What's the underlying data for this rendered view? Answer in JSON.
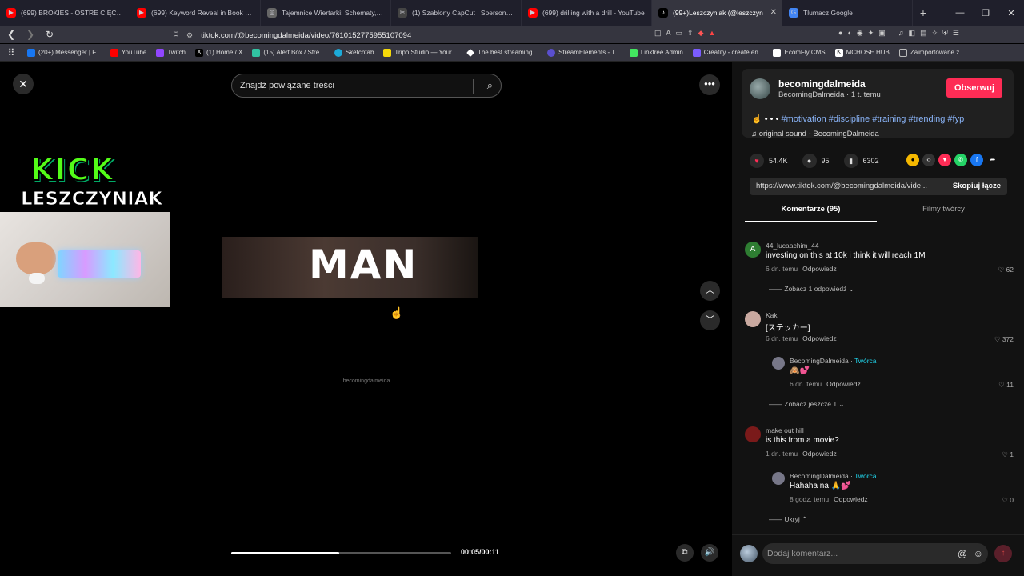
{
  "tabs": [
    {
      "label": "(699) BROKIES - OSTRE CIĘCIE - YouT",
      "color": "#ff0000",
      "icon": "youtube-icon"
    },
    {
      "label": "(699) Keyword Reveal in Book effect",
      "color": "#ff0000",
      "icon": "youtube-icon"
    },
    {
      "label": "Tajemnice Wiertarki: Schematy, Fizyk",
      "color": "#888888",
      "icon": "globe-icon"
    },
    {
      "label": "(1) Szablony CapCut | Spersonaliz",
      "color": "#444444",
      "icon": "capcut-icon"
    },
    {
      "label": "(699) drilling with a drill - YouTube",
      "color": "#ff0000",
      "icon": "youtube-icon"
    },
    {
      "label": "(99+)Leszczyniak (@leszczyn",
      "color": "#000000",
      "icon": "tiktok-icon"
    },
    {
      "label": "Tlumacz Google",
      "color": "#4285f4",
      "icon": "translate-icon"
    }
  ],
  "address": {
    "url": "tiktok.com/@becomingdalmeida/video/7610152775955107094"
  },
  "bookmarks": [
    {
      "label": "(20+) Messenger | F...",
      "color": "#1877f2"
    },
    {
      "label": "YouTube",
      "color": "#ff0000"
    },
    {
      "label": "Twitch",
      "color": "#9146ff"
    },
    {
      "label": "(1) Home / X",
      "color": "#000000"
    },
    {
      "label": "(15) Alert Box / Stre...",
      "color": "#31c3a2"
    },
    {
      "label": "Sketchfab",
      "color": "#1caad9"
    },
    {
      "label": "Tripo Studio — Your...",
      "color": "#f5d90a"
    },
    {
      "label": "The best streaming...",
      "color": "#ffffff"
    },
    {
      "label": "StreamElements - T...",
      "color": "#5a4fcf"
    },
    {
      "label": "Linktree Admin",
      "color": "#43e660"
    },
    {
      "label": "Creatify - create en...",
      "color": "#7a5cff"
    },
    {
      "label": "EcomFly CMS",
      "color": "#ffffff"
    },
    {
      "label": "MCHOSE HUB",
      "color": "#ffffff"
    },
    {
      "label": "Zaimportowane z...",
      "color": "#999999"
    }
  ],
  "stream": {
    "kick": "KICK",
    "name": "LESZCZYNIAK"
  },
  "video": {
    "search_placeholder": "Znajdź powiązane treści",
    "overlay_text": "MAN",
    "watermark": "becomingdalmeida",
    "time": "00:05/00:11",
    "progress": 0.49
  },
  "post": {
    "username": "becomingdalmeida",
    "subtitle": "BecomingDalmeida · 1 t. temu",
    "follow": "Obserwuj",
    "desc_prefix": "☝️ • • •",
    "hashtags": "#motivation #discipline #training #trending #fyp",
    "sound": "original sound - BecomingDalmeida",
    "likes": "54.4K",
    "comments": "95",
    "saves": "6302",
    "link": "https://www.tiktok.com/@becomingdalmeida/vide...",
    "copy": "Skopiuj łącze"
  },
  "panel_tabs": {
    "comments": "Komentarze (95)",
    "creator": "Filmy twórcy"
  },
  "comments": [
    {
      "user": "44_lucaachim_44",
      "text": "investing on this at 10k i think it will reach 1M",
      "time": "6 dn. temu",
      "reply": "Odpowiedz",
      "likes": "62",
      "more": "Zobacz 1 odpowiedź"
    },
    {
      "user": "Kak",
      "text": "[ステッカー]",
      "time": "6 dn. temu",
      "reply": "Odpowiedz",
      "likes": "372"
    },
    {
      "user": "BecomingDalmeida",
      "badge": "Twórca",
      "text": "🙈💕",
      "time": "6 dn. temu",
      "reply": "Odpowiedz",
      "likes": "11",
      "more": "Zobacz jeszcze 1"
    },
    {
      "user": "make out hill",
      "text": "is this from a movie?",
      "time": "1 dn. temu",
      "reply": "Odpowiedz",
      "likes": "1"
    },
    {
      "user": "BecomingDalmeida",
      "badge": "Twórca",
      "text": "Hahaha na 🙏💕",
      "time": "8 godz. temu",
      "reply": "Odpowiedz",
      "likes": "0",
      "more": "Ukryj"
    }
  ],
  "add_comment": {
    "placeholder": "Dodaj komentarz..."
  }
}
